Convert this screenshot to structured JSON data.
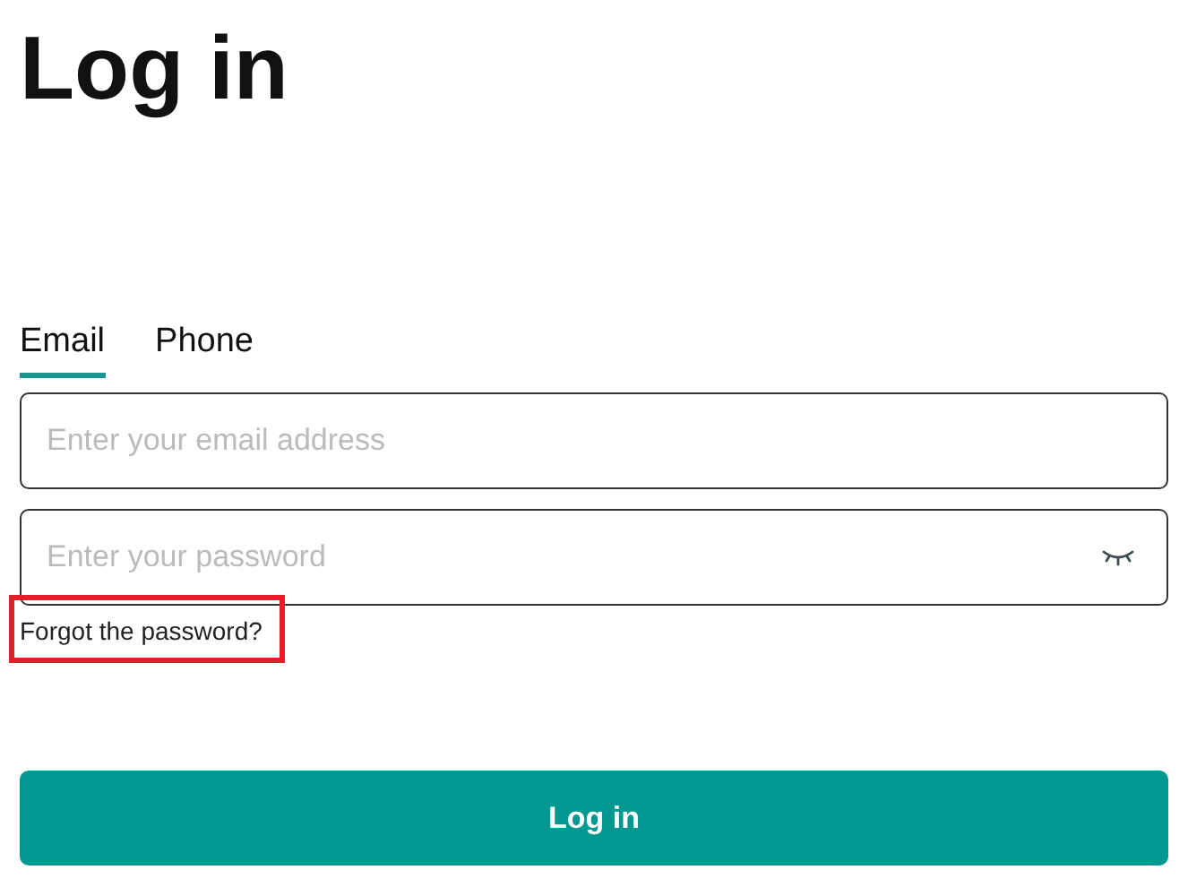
{
  "title": "Log in",
  "tabs": [
    {
      "label": "Email",
      "selected": true
    },
    {
      "label": "Phone",
      "selected": false
    }
  ],
  "email_field": {
    "placeholder": "Enter your email address"
  },
  "password_field": {
    "placeholder": "Enter your password",
    "visible": false
  },
  "forgot_link": {
    "label": "Forgot the password?",
    "highlighted": true
  },
  "submit_button": {
    "label": "Log in"
  }
}
